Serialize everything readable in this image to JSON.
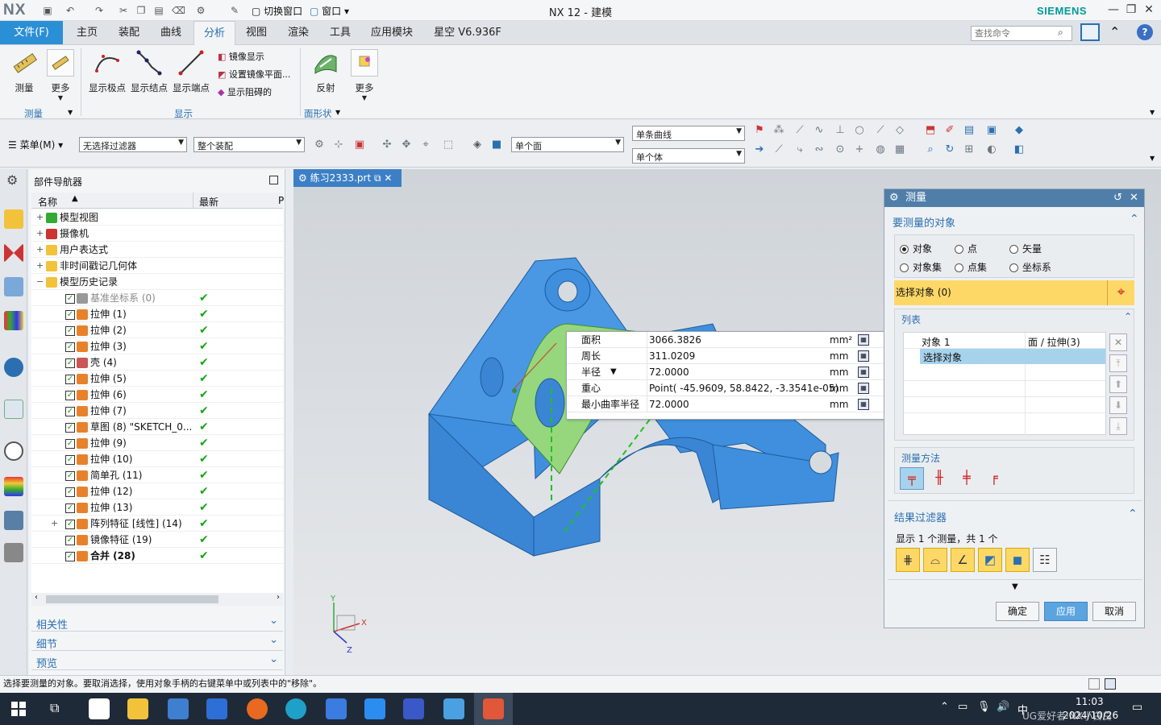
{
  "titlebar": {
    "logo": "NX",
    "title": "NX 12 - 建模",
    "brand": "SIEMENS",
    "switch_window": "切换窗口",
    "window_menu": "窗口"
  },
  "tabs": {
    "file": "文件(F)",
    "items": [
      "主页",
      "装配",
      "曲线",
      "分析",
      "视图",
      "渲染",
      "工具",
      "应用模块",
      "星空 V6.936F"
    ],
    "active": "分析"
  },
  "search": {
    "placeholder": "查找命令"
  },
  "ribbon": {
    "measure": "测量",
    "more1": "更多",
    "group_measure": "测量",
    "show_poles": "显示极点",
    "show_knots": "显示结点",
    "show_endpoints": "显示端点",
    "mirror_display": "镜像显示",
    "set_mirror_plane": "设置镜像平面...",
    "show_blocking": "显示阻碍的",
    "group_display": "显示",
    "reflect": "反射",
    "more2": "更多",
    "group_face_shape": "面形状"
  },
  "toolbar": {
    "menu": "菜单(M)",
    "filter": "无选择过滤器",
    "assembly": "整个装配",
    "face_rule": "单个面",
    "curve_rule": "单条曲线",
    "body_rule": "单个体"
  },
  "navigator": {
    "title": "部件导航器",
    "col_name": "名称",
    "col_latest": "最新",
    "col_extra": "P",
    "rows": [
      {
        "label": "模型视图",
        "indent": 0,
        "exp": "+",
        "ok": false,
        "cb": false
      },
      {
        "label": "摄像机",
        "indent": 0,
        "exp": "+",
        "ok": false,
        "cb": false
      },
      {
        "label": "用户表达式",
        "indent": 0,
        "exp": "+",
        "ok": false,
        "cb": false
      },
      {
        "label": "非时间戳记几何体",
        "indent": 0,
        "exp": "+",
        "ok": false,
        "cb": false
      },
      {
        "label": "模型历史记录",
        "indent": 0,
        "exp": "-",
        "ok": false,
        "cb": false
      },
      {
        "label": "基准坐标系 (0)",
        "indent": 1,
        "exp": "",
        "ok": true,
        "cb": true,
        "grey": true
      },
      {
        "label": "拉伸 (1)",
        "indent": 1,
        "exp": "",
        "ok": true,
        "cb": true
      },
      {
        "label": "拉伸 (2)",
        "indent": 1,
        "exp": "",
        "ok": true,
        "cb": true
      },
      {
        "label": "拉伸 (3)",
        "indent": 1,
        "exp": "",
        "ok": true,
        "cb": true
      },
      {
        "label": "壳 (4)",
        "indent": 1,
        "exp": "",
        "ok": true,
        "cb": true
      },
      {
        "label": "拉伸 (5)",
        "indent": 1,
        "exp": "",
        "ok": true,
        "cb": true
      },
      {
        "label": "拉伸 (6)",
        "indent": 1,
        "exp": "",
        "ok": true,
        "cb": true
      },
      {
        "label": "拉伸 (7)",
        "indent": 1,
        "exp": "",
        "ok": true,
        "cb": true
      },
      {
        "label": "草图 (8) \"SKETCH_0...",
        "indent": 1,
        "exp": "",
        "ok": true,
        "cb": true
      },
      {
        "label": "拉伸 (9)",
        "indent": 1,
        "exp": "",
        "ok": true,
        "cb": true
      },
      {
        "label": "拉伸 (10)",
        "indent": 1,
        "exp": "",
        "ok": true,
        "cb": true
      },
      {
        "label": "简单孔 (11)",
        "indent": 1,
        "exp": "",
        "ok": true,
        "cb": true
      },
      {
        "label": "拉伸 (12)",
        "indent": 1,
        "exp": "",
        "ok": true,
        "cb": true
      },
      {
        "label": "拉伸 (13)",
        "indent": 1,
        "exp": "",
        "ok": true,
        "cb": true
      },
      {
        "label": "阵列特征 [线性] (14)",
        "indent": 1,
        "exp": "+",
        "ok": true,
        "cb": true
      },
      {
        "label": "镜像特征 (19)",
        "indent": 1,
        "exp": "",
        "ok": true,
        "cb": true
      },
      {
        "label": "合并 (28)",
        "indent": 1,
        "exp": "",
        "ok": true,
        "cb": true,
        "bold": true
      }
    ],
    "sections": [
      "相关性",
      "细节",
      "预览"
    ]
  },
  "viewport": {
    "doc_tab": "练习2333.prt",
    "axis_x": "X",
    "axis_y": "Y",
    "axis_z": "Z"
  },
  "info": {
    "rows": [
      {
        "k": "面积",
        "v": "3066.3826",
        "u": "mm²"
      },
      {
        "k": "周长",
        "v": "311.0209",
        "u": "mm"
      },
      {
        "k": "半径",
        "v": "72.0000",
        "u": "mm",
        "dd": "▼"
      },
      {
        "k": "重心",
        "v": "Point( -45.9609, 58.8422, -3.3541e-05)",
        "u": "mm"
      },
      {
        "k": "最小曲率半径",
        "v": "72.0000",
        "u": "mm"
      }
    ]
  },
  "dialog": {
    "title": "测量",
    "sec_target": "要测量的对象",
    "radios": [
      "对象",
      "点",
      "矢量",
      "对象集",
      "点集",
      "坐标系"
    ],
    "select_object": "选择对象 (0)",
    "sec_list": "列表",
    "list_row1_a": "对象 1",
    "list_row1_b": "面 / 拉伸(3)",
    "list_row2": "选择对象",
    "sec_method": "测量方法",
    "sec_filter": "结果过滤器",
    "filter_summary": "显示 1 个测量，共 1 个",
    "ok": "确定",
    "apply": "应用",
    "cancel": "取消"
  },
  "status": {
    "text": "选择要测量的对象。要取消选择，使用对象手柄的右键菜单中或列表中的\"移除\"。"
  },
  "taskbar": {
    "time": "11:03",
    "date": "2024/10/26",
    "ime": "中",
    "watermark": "UG爱好者·NX小白白"
  },
  "colors": {
    "accent": "#2b8fd6",
    "brand": "#009999",
    "part": "#3d8fe0",
    "face": "#8fd07a",
    "highlight": "#fdd867"
  }
}
